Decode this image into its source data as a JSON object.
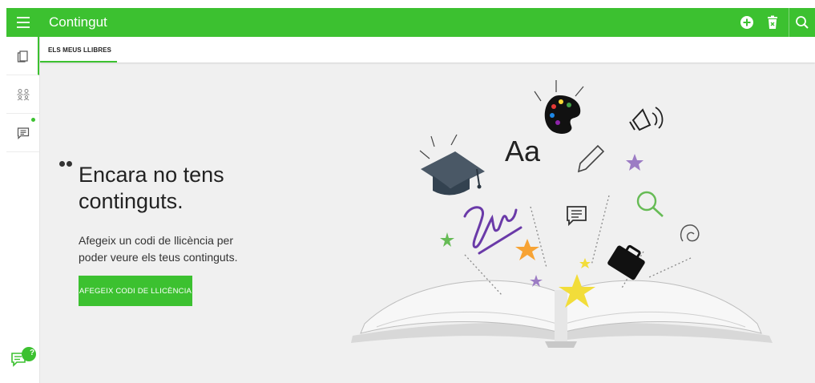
{
  "app": {
    "title": "Contingut"
  },
  "topbar": {
    "icons": [
      "menu-icon",
      "add-circle-icon",
      "delete-icon",
      "search-icon"
    ]
  },
  "sidebar": {
    "items": [
      {
        "icon": "books-icon",
        "active": true
      },
      {
        "icon": "groups-icon",
        "active": false
      },
      {
        "icon": "messages-icon",
        "active": false,
        "notification": true
      }
    ],
    "help_icon": "help-chat-icon",
    "help_badge": "?"
  },
  "tabs": [
    {
      "label": "ELS MEUS LLIBRES",
      "active": true
    }
  ],
  "empty_state": {
    "title": "Encara no tens continguts.",
    "description": "Afegeix un codi de llicència per poder veure els teus continguts.",
    "button_label": "AFEGEIX CODI DE LLICÈNCIA"
  },
  "illustration": {
    "letters": "Aa"
  },
  "colors": {
    "accent": "#3cc130",
    "background": "#f0f0f0",
    "text": "#222222"
  }
}
